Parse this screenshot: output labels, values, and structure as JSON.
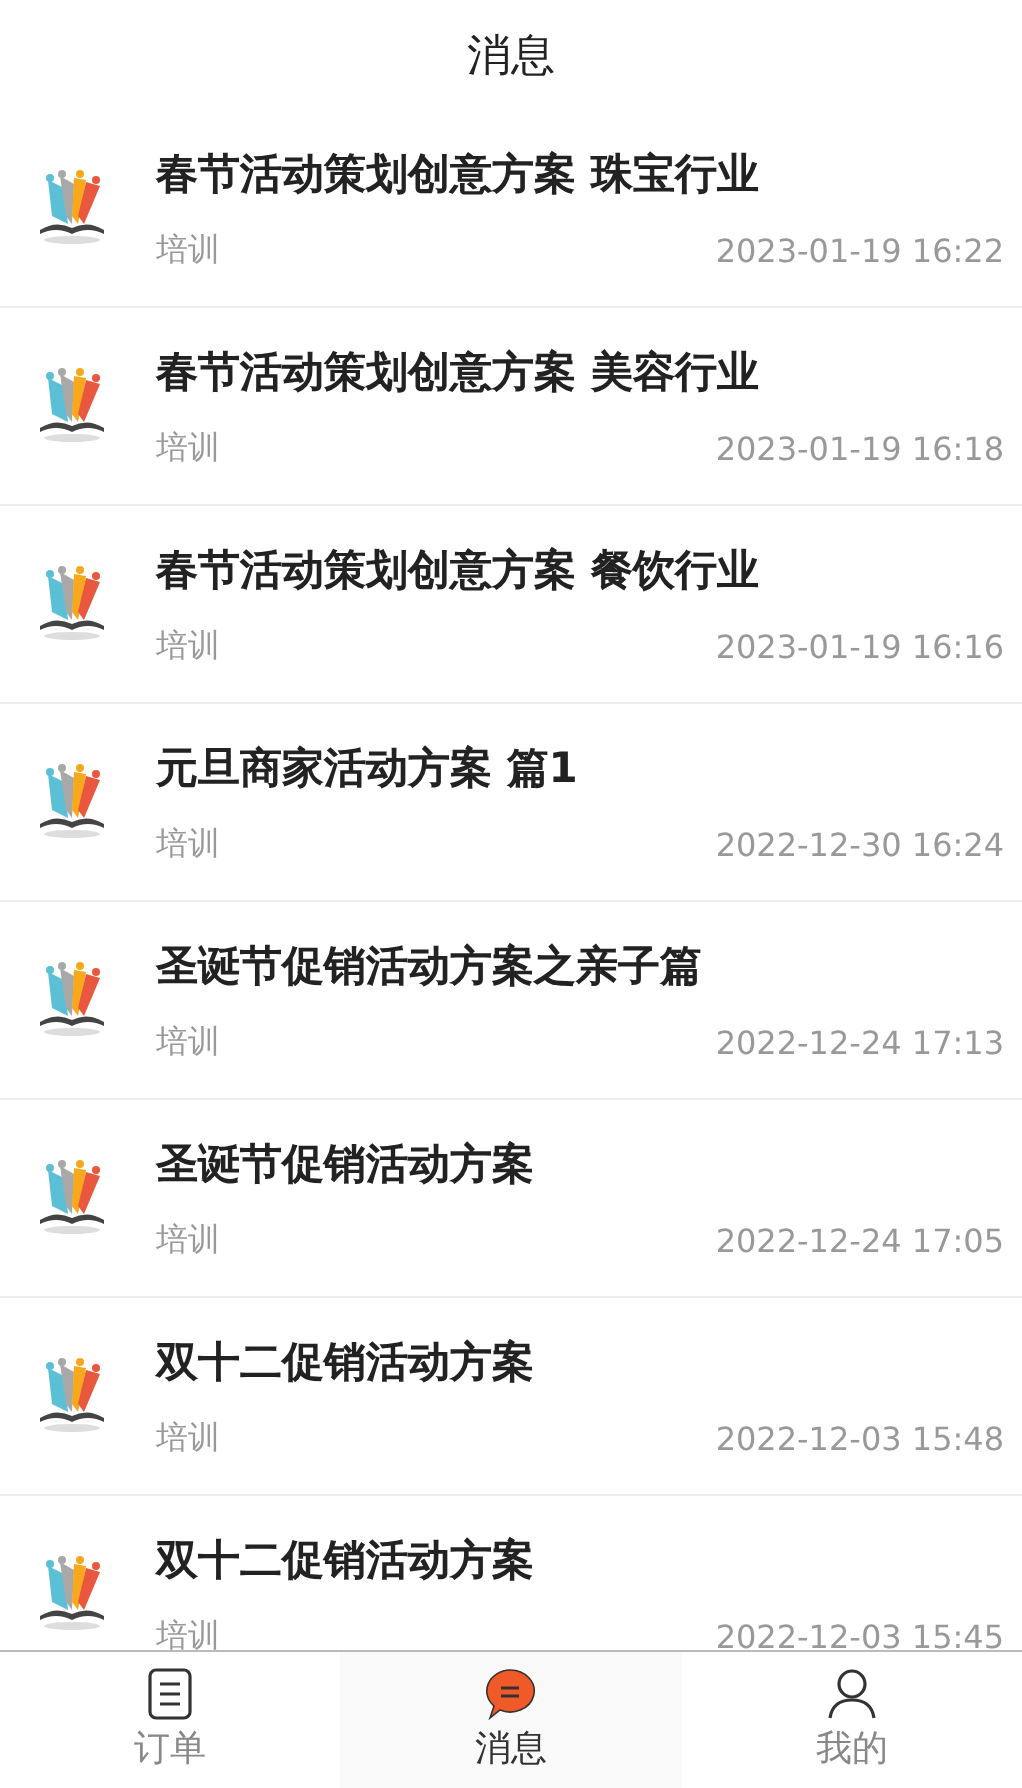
{
  "header": {
    "title": "消息"
  },
  "messages": [
    {
      "title": "春节活动策划创意方案 珠宝行业",
      "category": "培训",
      "time": "2023-01-19 16:22"
    },
    {
      "title": "春节活动策划创意方案 美容行业",
      "category": "培训",
      "time": "2023-01-19 16:18"
    },
    {
      "title": "春节活动策划创意方案 餐饮行业",
      "category": "培训",
      "time": "2023-01-19 16:16"
    },
    {
      "title": "元旦商家活动方案 篇1",
      "category": "培训",
      "time": "2022-12-30 16:24"
    },
    {
      "title": "圣诞节促销活动方案之亲子篇",
      "category": "培训",
      "time": "2022-12-24 17:13"
    },
    {
      "title": "圣诞节促销活动方案",
      "category": "培训",
      "time": "2022-12-24 17:05"
    },
    {
      "title": "双十二促销活动方案",
      "category": "培训",
      "time": "2022-12-03 15:48"
    },
    {
      "title": "双十二促销活动方案",
      "category": "培训",
      "time": "2022-12-03 15:45"
    }
  ],
  "tabs": [
    {
      "kind": "orders",
      "label": "订单",
      "selected": false
    },
    {
      "kind": "messages",
      "label": "消息",
      "selected": true
    },
    {
      "kind": "profile",
      "label": "我的",
      "selected": false
    }
  ]
}
